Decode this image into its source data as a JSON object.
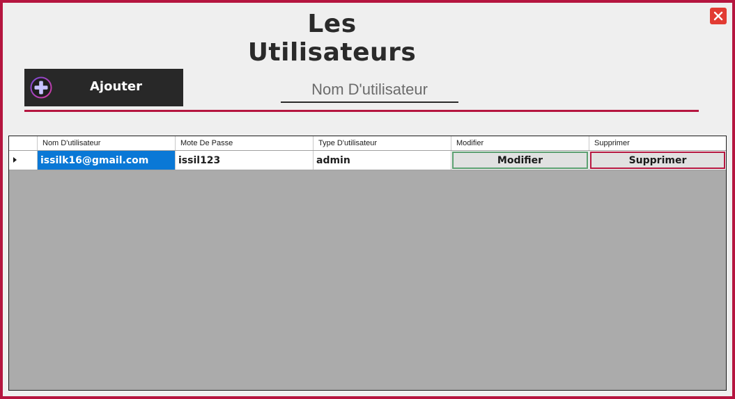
{
  "window": {
    "title": "Les Utilisateurs",
    "accent_color": "#b5153f",
    "close_icon": "close-icon"
  },
  "toolbar": {
    "add_label": "Ajouter",
    "add_icon": "plus-circle-icon",
    "search_placeholder": "Nom D'utilisateur",
    "search_value": ""
  },
  "table": {
    "columns": [
      "Nom D'utilisateur",
      "Mote De Passe",
      "Type D'utilisateur",
      "Modifier",
      "Supprimer"
    ],
    "rows": [
      {
        "username": "issilk16@gmail.com",
        "password": "issil123",
        "type": "admin",
        "modify_label": "Modifier",
        "delete_label": "Supprimer"
      }
    ]
  }
}
